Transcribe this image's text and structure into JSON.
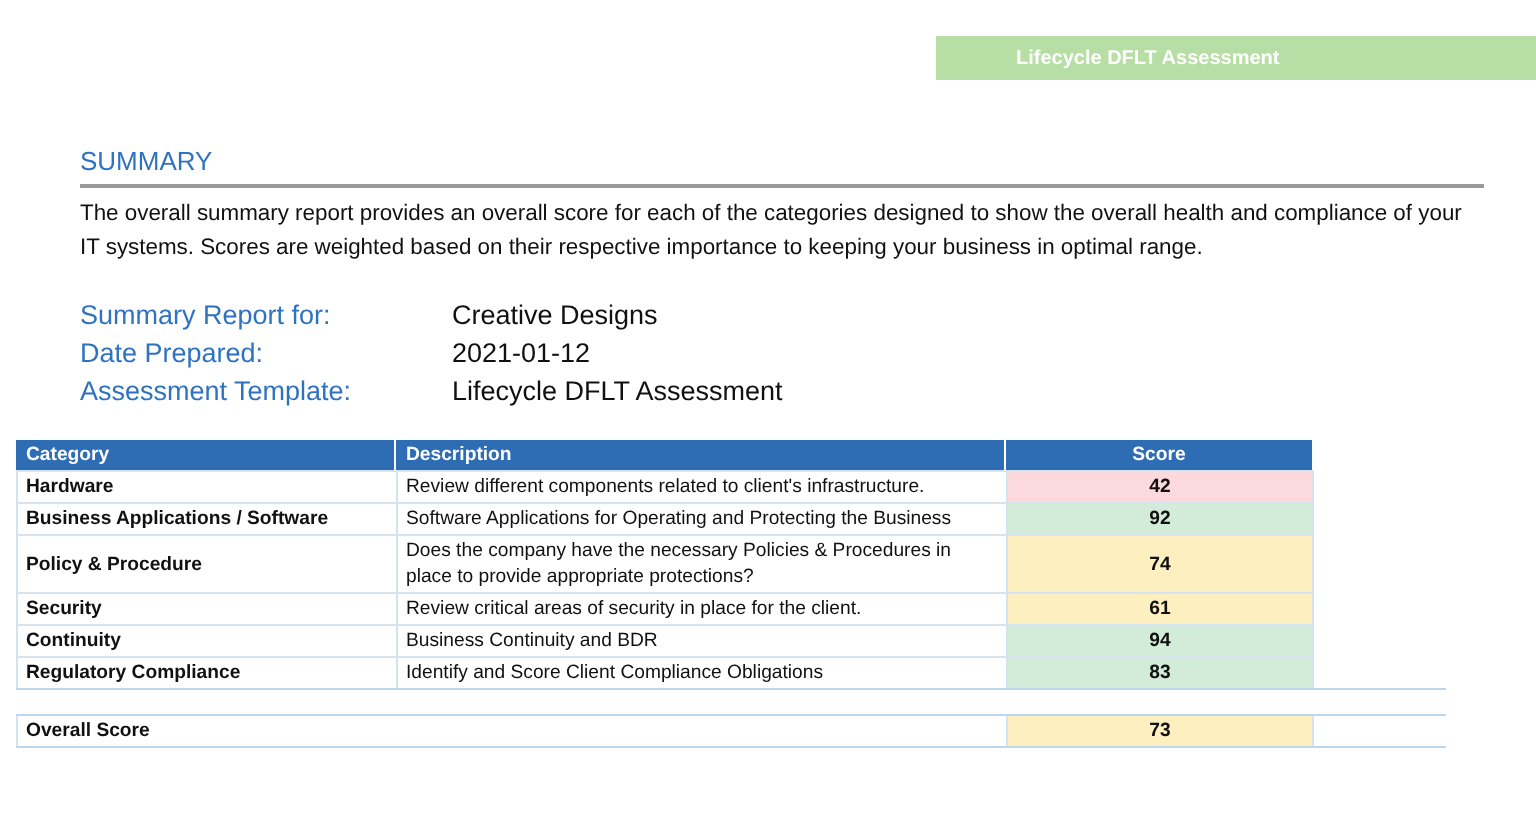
{
  "banner": "Lifecycle DFLT Assessment",
  "heading": "SUMMARY",
  "intro": "The overall summary report provides an overall score for each of the categories designed to show the overall health and compliance of your IT systems. Scores are weighted based on their respective importance to keeping your business in optimal range.",
  "details": [
    {
      "label": "Summary Report for:",
      "value": "Creative Designs"
    },
    {
      "label": "Date Prepared:",
      "value": "2021-01-12"
    },
    {
      "label": "Assessment Template:",
      "value": "Lifecycle DFLT Assessment"
    }
  ],
  "table": {
    "columns": [
      "Category",
      "Description",
      "Score"
    ],
    "rows": [
      {
        "category": "Hardware",
        "description": "Review different components related to client's infrastructure.",
        "score": "42",
        "color": "#fbd9dc"
      },
      {
        "category": "Business Applications / Software",
        "description": "Software Applications for Operating and Protecting the Business",
        "score": "92",
        "color": "#d3ecd9"
      },
      {
        "category": "Policy & Procedure",
        "description": "Does the company have the necessary Policies & Procedures in place to provide appropriate protections?",
        "score": "74",
        "color": "#fdefc0"
      },
      {
        "category": "Security",
        "description": "Review critical areas of security in place for the client.",
        "score": "61",
        "color": "#fdefc0"
      },
      {
        "category": "Continuity",
        "description": "Business Continuity and BDR",
        "score": "94",
        "color": "#d3ecd9"
      },
      {
        "category": "Regulatory Compliance",
        "description": "Identify and Score Client Compliance Obligations",
        "score": "83",
        "color": "#d3ecd9"
      }
    ]
  },
  "overall": {
    "label": "Overall Score",
    "score": "73",
    "color": "#fdefc0"
  }
}
